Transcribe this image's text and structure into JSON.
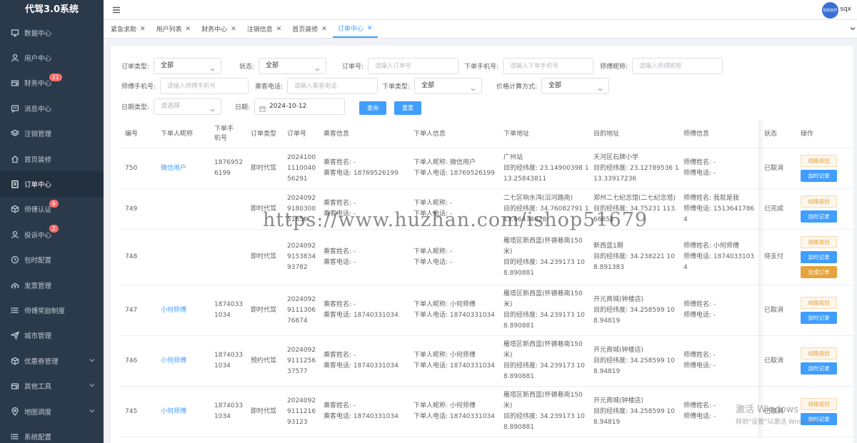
{
  "app": {
    "title": "代驾3.0系统"
  },
  "topbar": {
    "avatar_text": "他的好作",
    "username": "sqx"
  },
  "sidebar": {
    "items": [
      {
        "label": "数据中心",
        "icon": "monitor-icon"
      },
      {
        "label": "用户中心",
        "icon": "user-icon"
      },
      {
        "label": "财务中心",
        "icon": "wallet-icon",
        "badge": "21"
      },
      {
        "label": "消息中心",
        "icon": "message-icon"
      },
      {
        "label": "注销管理",
        "icon": "layers-icon"
      },
      {
        "label": "首页装修",
        "icon": "home-icon"
      },
      {
        "label": "订单中心",
        "icon": "document-icon",
        "active": true
      },
      {
        "label": "师傅认证",
        "icon": "box-icon",
        "badge": "6"
      },
      {
        "label": "投诉中心",
        "icon": "user-icon",
        "badge": "2"
      },
      {
        "label": "包时配置",
        "icon": "clock-icon"
      },
      {
        "label": "发票管理",
        "icon": "cloud-upload-icon"
      },
      {
        "label": "师傅奖励制度",
        "icon": "list-icon"
      },
      {
        "label": "城市管理",
        "icon": "send-icon"
      },
      {
        "label": "优惠券管理",
        "icon": "box-icon",
        "has_children": true
      },
      {
        "label": "其他工具",
        "icon": "wallet-icon",
        "has_children": true
      },
      {
        "label": "地图调度",
        "icon": "location-icon",
        "has_children": true
      },
      {
        "label": "系统配置",
        "icon": "list-icon"
      }
    ]
  },
  "tabs": [
    {
      "label": "紧急求助"
    },
    {
      "label": "用户列表"
    },
    {
      "label": "财务中心"
    },
    {
      "label": "注销信息"
    },
    {
      "label": "首页装修"
    },
    {
      "label": "订单中心",
      "active": true
    }
  ],
  "filters": {
    "order_type_label": "订单类型:",
    "order_type_value": "全部",
    "status_label": "状态:",
    "status_value": "全部",
    "order_no_label": "订单号:",
    "order_no_placeholder": "请输入订单号",
    "buyer_phone_label": "下单手机号:",
    "buyer_phone_placeholder": "请输入下单手机号",
    "driver_nick_label": "师傅昵称:",
    "driver_nick_placeholder": "请输入师傅昵称",
    "driver_phone_label": "师傅手机号:",
    "driver_phone_placeholder": "请输入师傅手机号",
    "passenger_phone_label": "乘客电话:",
    "passenger_phone_placeholder": "请输入乘客电话",
    "place_type_label": "下单类型:",
    "place_type_value": "全部",
    "pricing_label": "价格计算方式:",
    "pricing_value": "全部",
    "date_type_label": "日期类型:",
    "date_type_placeholder": "请选择",
    "date_label": "日期:",
    "date_value": "2024-10-12",
    "query_button": "查询",
    "reset_button": "重置"
  },
  "table": {
    "columns": [
      "编号",
      "下单人昵称",
      "下单手机号",
      "订单类型",
      "订单号",
      "乘客信息",
      "下单人信息",
      "下单地址",
      "目的地址",
      "师傅信息",
      "状态",
      "操作"
    ],
    "op_route": "线路规划",
    "op_log": "加时记录",
    "op_complete": "完成订单",
    "rows": [
      {
        "id": "750",
        "nickname": "微信用户",
        "phone": "18769526199",
        "type": "即时代驾",
        "order_no": "20241001110040 56291",
        "passenger": [
          "乘客姓名: -",
          "乘客电话: 18769526199"
        ],
        "buyer": [
          "下单人昵称: 微信用户",
          "下单人电话: 18769526199"
        ],
        "origin": [
          "广州站",
          "目的经纬度: 23.14900398 113.25843811"
        ],
        "dest": [
          "天河区石牌小学",
          "目的经纬度: 23.12789536 113.33917236"
        ],
        "driver": [
          "师傅姓名: -",
          "师傅电话: -"
        ],
        "status": "已取消",
        "complete": false
      },
      {
        "id": "749",
        "nickname": "",
        "phone": "",
        "type": "即时代驾",
        "order_no": "20240929180300 51656",
        "passenger": [
          "乘客姓名: -",
          "乘客电话: -"
        ],
        "buyer": [
          "下单人昵称: -",
          "下单人电话: -"
        ],
        "origin": [
          "二七区响水湾(沿河路南)",
          "目的经纬度: 34.76082791 113.66434028"
        ],
        "dest": [
          "郑州二七纪念馆(二七纪念塔)",
          "目的经纬度: 34.75231 113.66652"
        ],
        "driver": [
          "师傅姓名: 我就是我",
          "师傅电话: 15136417864"
        ],
        "status": "已完成",
        "complete": false
      },
      {
        "id": "748",
        "nickname": "",
        "phone": "",
        "type": "即时代驾",
        "order_no": "2024092915383493782",
        "passenger": [
          "乘客姓名: -",
          "乘客电话: -"
        ],
        "buyer": [
          "下单人昵称: -",
          "下单人电话: -"
        ],
        "origin": [
          "雁塔区新西蓝(怀德巷南150米)",
          "目的经纬度: 34.239173 108.890881"
        ],
        "dest": [
          "新西蓝1期",
          "目的经纬度: 34.238221 108.891383"
        ],
        "driver": [
          "师傅姓名: 小何师傅",
          "师傅电话: 18740331034"
        ],
        "status": "待支付",
        "complete": true
      },
      {
        "id": "747",
        "nickname": "小何师傅",
        "phone": "18740331034",
        "type": "即时代驾",
        "order_no": "2024092911130676674",
        "passenger": [
          "乘客姓名: -",
          "乘客电话: 18740331034"
        ],
        "buyer": [
          "下单人昵称: 小何师傅",
          "下单人电话: 18740331034"
        ],
        "origin": [
          "雁塔区新西蓝(怀德巷南150米)",
          "目的经纬度: 34.239173 108.890881"
        ],
        "dest": [
          "开元商城(钟楼店)",
          "目的经纬度: 34.258599 108.94819"
        ],
        "driver": [
          "师傅姓名: -",
          "师傅电话: -"
        ],
        "status": "已取消",
        "complete": false
      },
      {
        "id": "746",
        "nickname": "小何师傅",
        "phone": "18740331034",
        "type": "预约代驾",
        "order_no": "2024092911125637577",
        "passenger": [
          "乘客姓名: -",
          "乘客电话: 18740331034"
        ],
        "buyer": [
          "下单人昵称: 小何师傅",
          "下单人电话: 18740331034"
        ],
        "origin": [
          "雁塔区新西蓝(怀德巷南150米)",
          "目的经纬度: 34.239173 108.890881"
        ],
        "dest": [
          "开元商城(钟楼店)",
          "目的经纬度: 34.258599 108.94819"
        ],
        "driver": [
          "师傅姓名: -",
          "师傅电话: -"
        ],
        "status": "已取消",
        "complete": false
      },
      {
        "id": "745",
        "nickname": "小何师傅",
        "phone": "18740331034",
        "type": "即时代驾",
        "order_no": "2024092911121693123",
        "passenger": [
          "乘客姓名: -",
          "乘客电话: 18740331034"
        ],
        "buyer": [
          "下单人昵称: 小何师傅",
          "下单人电话: 18740331034"
        ],
        "origin": [
          "雁塔区新西蓝(怀德巷南150米)",
          "目的经纬度: 34.239173 108.890881"
        ],
        "dest": [
          "开元商城(钟楼店)",
          "目的经纬度: 34.258599 108.94819"
        ],
        "driver": [
          "师傅姓名: -",
          "师傅电话: -"
        ],
        "status": "已取消",
        "complete": false
      }
    ]
  },
  "overlay": {
    "watermark": "https://www.huzhan.com/ishop51679",
    "activate_title": "激活 Windows",
    "activate_sub": "转到\"设置\"以激活 Windows。"
  }
}
